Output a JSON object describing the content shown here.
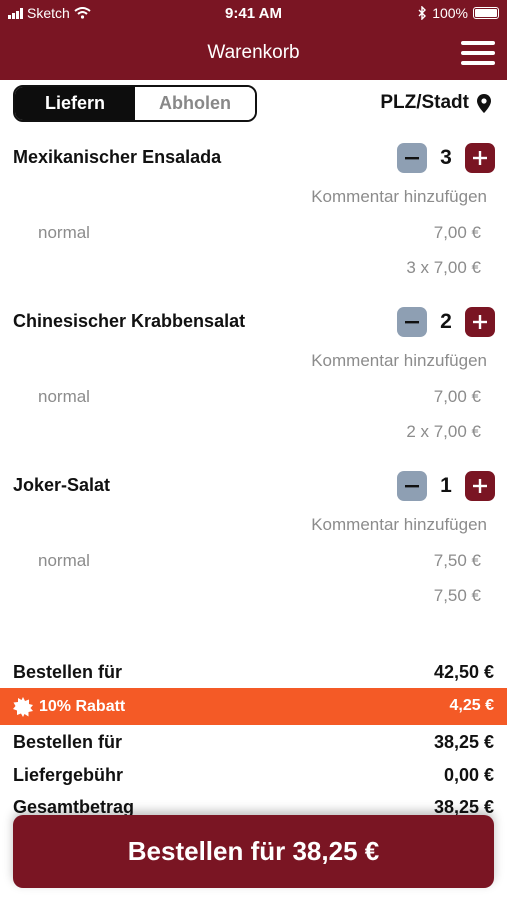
{
  "status_bar": {
    "carrier": "Sketch",
    "time": "9:41 AM",
    "battery": "100%"
  },
  "header": {
    "title": "Warenkorb",
    "menu_icon": "hamburger-menu-icon"
  },
  "delivery_mode": {
    "options": [
      "Liefern",
      "Abholen"
    ],
    "selected": "Liefern"
  },
  "location": {
    "label": "PLZ/Stadt",
    "icon": "map-pin-icon"
  },
  "items": [
    {
      "name": "Mexikanischer Ensalada",
      "quantity": "3",
      "comment_label": "Kommentar hinzufügen",
      "variant": "normal",
      "unit_price": "7,00 €",
      "line_total": "3 x 7,00 €"
    },
    {
      "name": "Chinesischer Krabbensalat",
      "quantity": "2",
      "comment_label": "Kommentar hinzufügen",
      "variant": "normal",
      "unit_price": "7,00 €",
      "line_total": "2 x 7,00 €"
    },
    {
      "name": "Joker-Salat",
      "quantity": "1",
      "comment_label": "Kommentar hinzufügen",
      "variant": "normal",
      "unit_price": "7,50 €",
      "line_total": "7,50 €"
    }
  ],
  "summary": {
    "subtotal_label": "Bestellen für",
    "subtotal_value": "42,50 €",
    "discount_label": "10% Rabatt",
    "discount_value": "4,25 €",
    "after_discount_label": "Bestellen für",
    "after_discount_value": "38,25 €",
    "delivery_fee_label": "Liefergebühr",
    "delivery_fee_value": "0,00 €",
    "total_label": "Gesamtbetrag",
    "total_value": "38,25 €"
  },
  "order_button": {
    "label": "Bestellen für 38,25 €"
  },
  "colors": {
    "brand": "#7a1523",
    "discount": "#f45a26",
    "stepper_minus": "#8e9fb3",
    "muted_text": "#8c8c8c"
  }
}
